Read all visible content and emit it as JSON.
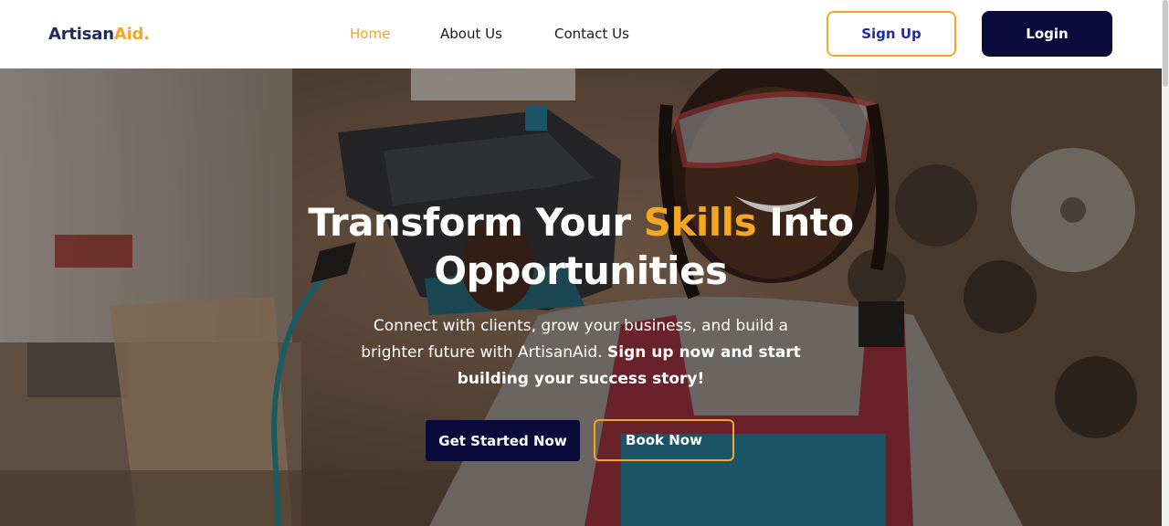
{
  "brand": {
    "name_main": "Artisan",
    "name_accent": "Aid."
  },
  "nav": {
    "links": [
      {
        "label": "Home",
        "active": true
      },
      {
        "label": "About Us",
        "active": false
      },
      {
        "label": "Contact Us",
        "active": false
      }
    ],
    "signup_label": "Sign Up",
    "login_label": "Login"
  },
  "hero": {
    "title_part1": "Transform Your ",
    "title_highlight": "Skills",
    "title_part2": " Into Opportunities",
    "subtitle_plain": "Connect with clients, grow your business, and build a brighter future with ArtisanAid. ",
    "subtitle_bold": "Sign up now and start building your success story!",
    "primary_cta": "Get Started Now",
    "secondary_cta": "Book Now"
  },
  "colors": {
    "accent": "#f5a623",
    "navy": "#0b0b3b",
    "brand_text": "#1f2a5a"
  }
}
